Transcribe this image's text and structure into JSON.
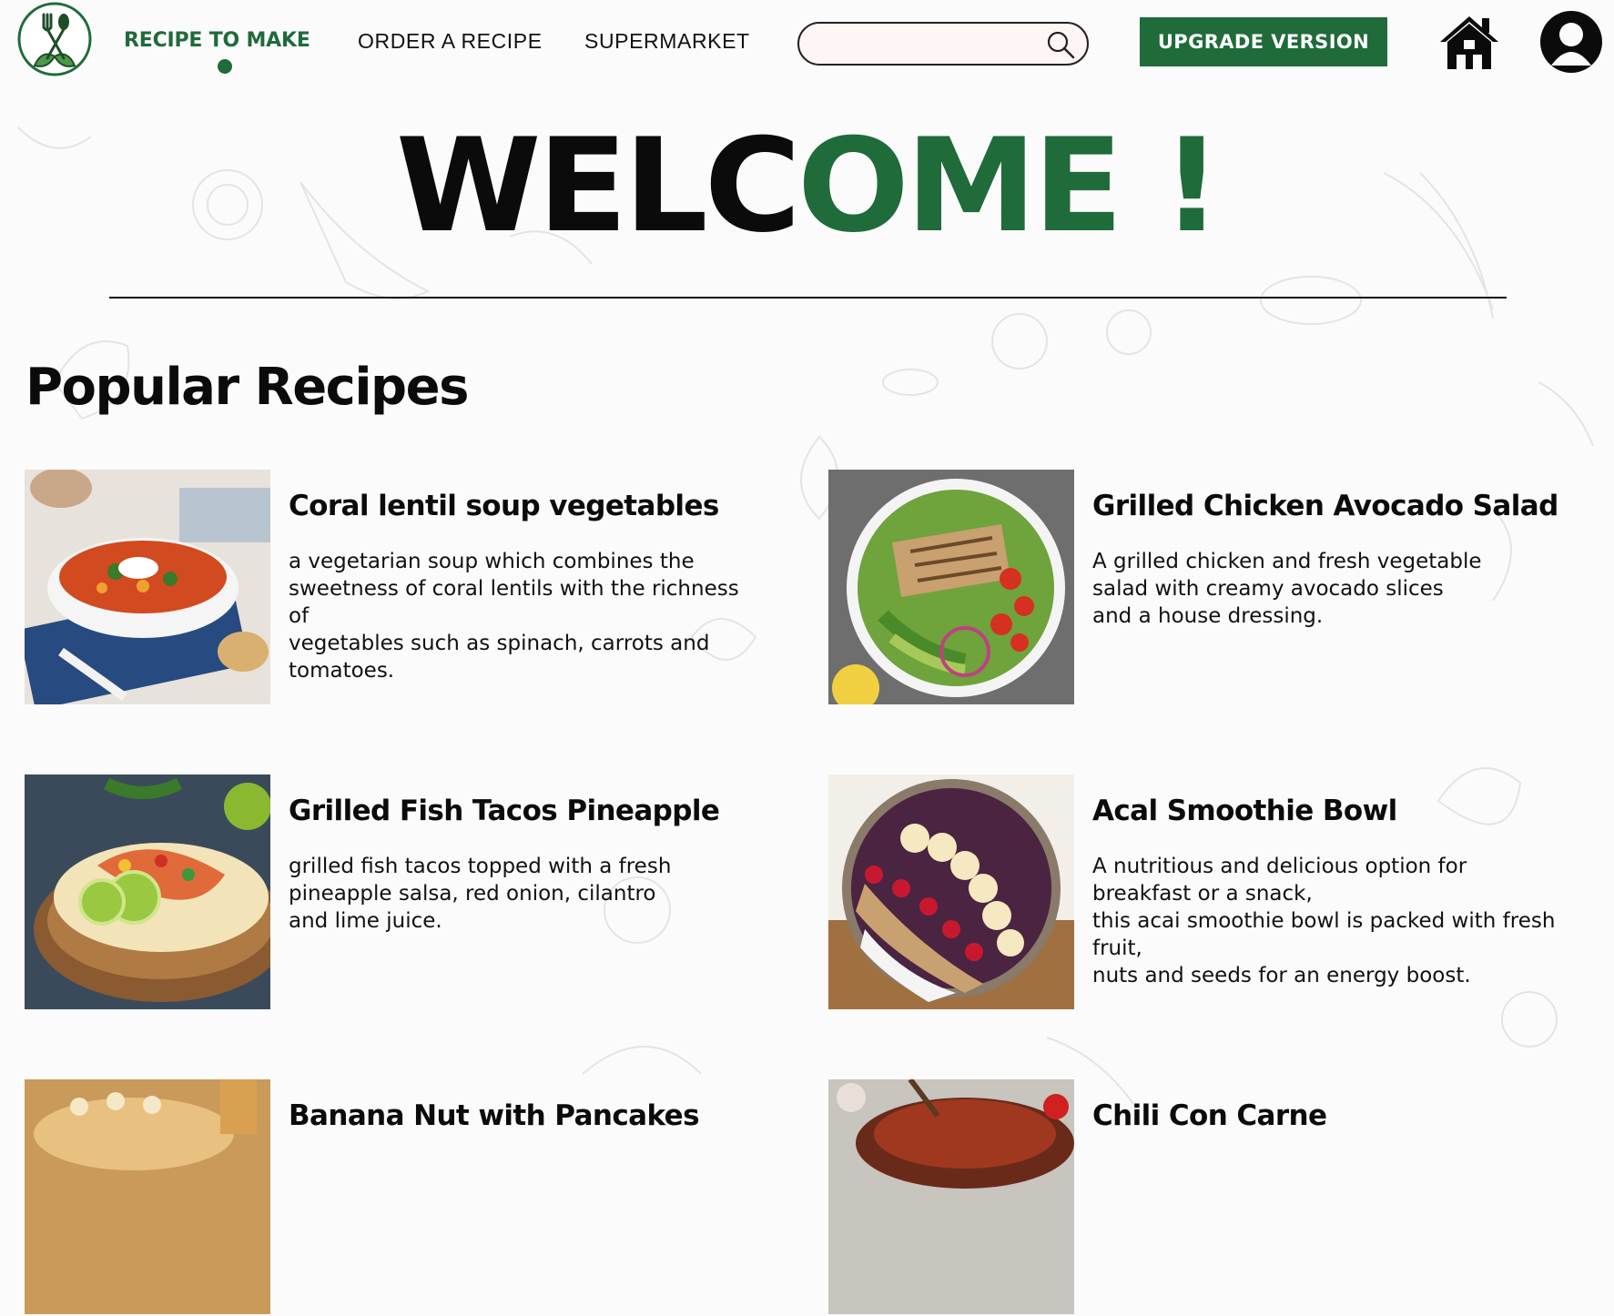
{
  "nav": {
    "logo_icon": "fork-spoon-leaf-logo-icon",
    "links": [
      "RECIPE TO MAKE",
      "ORDER A RECIPE",
      "SUPERMARKET"
    ],
    "active_index": 0
  },
  "search": {
    "value": "",
    "placeholder": "",
    "icon": "search-icon"
  },
  "upgrade_label": "UPGRADE VERSION",
  "icons": {
    "home": "home-icon",
    "user": "user-icon"
  },
  "welcome": {
    "part_black": "WELC",
    "part_green": "OME !"
  },
  "section_title": "Popular Recipes",
  "recipes": [
    {
      "title": "Coral lentil soup vegetables",
      "description": "a vegetarian soup which combines the\nsweetness of coral lentils with the richness\nof\nvegetables such as spinach, carrots and\ntomatoes.",
      "image": "lentil-soup-photo"
    },
    {
      "title": "Grilled Chicken Avocado Salad",
      "description": "A grilled chicken and fresh vegetable\nsalad with creamy avocado slices\nand a house dressing.",
      "image": "chicken-salad-photo"
    },
    {
      "title": "Grilled Fish Tacos Pineapple",
      "description": "grilled fish tacos topped with a fresh\npineapple salsa, red onion, cilantro\nand lime juice.",
      "image": "fish-tacos-photo"
    },
    {
      "title": "Acal Smoothie Bowl",
      "description": "A nutritious and delicious option for\nbreakfast or a snack,\nthis acai smoothie bowl is packed with fresh\nfruit,\nnuts and seeds for an energy boost.",
      "image": "acai-bowl-photo"
    },
    {
      "title": "Banana Nut with Pancakes",
      "description": "",
      "image": "pancakes-photo"
    },
    {
      "title": "Chili Con Carne",
      "description": "",
      "image": "chili-photo"
    }
  ],
  "colors": {
    "brand_green": "#1f6b3a",
    "text": "#0b0b0b",
    "background": "#fcfbfb"
  }
}
